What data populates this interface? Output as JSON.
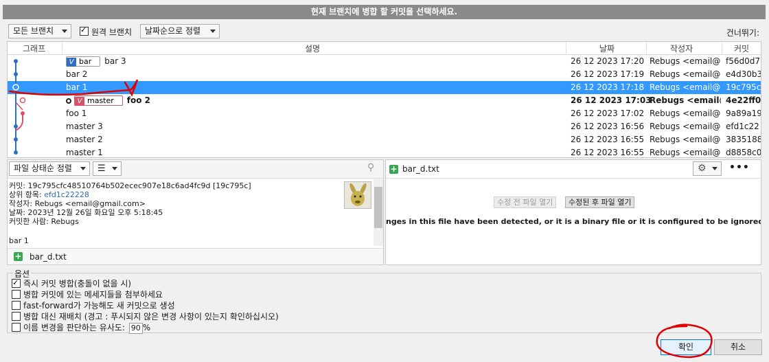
{
  "title": "현재 브랜치에 병합 할 커밋을 선택하세요.",
  "toolbar": {
    "branch_filter": "모든 브랜치",
    "remote_branches_label": "원격 브랜치",
    "remote_branches_checked": true,
    "sort_label": "날짜순으로 정렬",
    "skip_label": "건너뛰기:"
  },
  "columns": {
    "graph": "그래프",
    "description": "설명",
    "date": "날짜",
    "author": "작성자",
    "commit": "커밋"
  },
  "commits": [
    {
      "tag": "bar",
      "desc": "bar 3",
      "date": "26 12 2023 17:20",
      "author": "Rebugs <email@g",
      "commit": "f56d0d7"
    },
    {
      "tag": "",
      "desc": "bar 2",
      "date": "26 12 2023 17:19",
      "author": "Rebugs <email@g",
      "commit": "e4d30b3"
    },
    {
      "tag": "",
      "desc": "bar 1",
      "date": "26 12 2023 17:18",
      "author": "Rebugs <email@g",
      "commit": "19c795c"
    },
    {
      "tag": "master",
      "desc": "foo 2",
      "date": "26 12 2023 17:03",
      "author": "Rebugs <email@",
      "commit": "4e22ff0"
    },
    {
      "tag": "",
      "desc": "foo 1",
      "date": "26 12 2023 17:02",
      "author": "Rebugs <email@g",
      "commit": "9a89a19"
    },
    {
      "tag": "",
      "desc": "master 3",
      "date": "26 12 2023 16:56",
      "author": "Rebugs <email@g",
      "commit": "efd1c22"
    },
    {
      "tag": "",
      "desc": "master 2",
      "date": "26 12 2023 16:55",
      "author": "Rebugs <email@g",
      "commit": "3835188"
    },
    {
      "tag": "",
      "desc": "master 1",
      "date": "26 12 2023 16:55",
      "author": "Rebugs <email@g",
      "commit": "d8858c0"
    }
  ],
  "selected_row": 2,
  "details": {
    "file_sort": "파일 상태순 정렬",
    "view_mode_icon": "list-icon",
    "commit_label": "커밋:",
    "commit_value": "19c795cfc48510764b502ecec907e18c6ad4fc9d [19c795c]",
    "parent_label": "상위 항목:",
    "parent_value": "efd1c22228",
    "author_label": "작성자:",
    "author_value": "Rebugs <email@gmail.com>",
    "date_label": "날짜:",
    "date_value": "2023년 12월 26일 화요일 오후 5:18:45",
    "committer_label": "커밋한 사람:",
    "committer_value": "Rebugs",
    "message": "bar 1",
    "file": "bar_d.txt"
  },
  "diff": {
    "file": "bar_d.txt",
    "open_before": "수정 전 파일 열기",
    "open_after": "수정된 후 파일 열기",
    "message": "nges in this file have been detected, or it is a binary file or it is configured to be ignored by the file p"
  },
  "options": {
    "legend": "옵션",
    "items": [
      {
        "label": "즉시 커밋 병합(충돌이 없을 시)",
        "checked": true
      },
      {
        "label": "병합 커밋에 있는 메세지들을 첨부하세요",
        "checked": false
      },
      {
        "label": "fast-forward가 가능해도 새 커밋으로 생성",
        "checked": false
      },
      {
        "label": "병합 대신 재배치 (경고 : 푸시되지 않은 변경 사항이 있는지 확인하십시오)",
        "checked": false
      },
      {
        "label": "이름 변경을 판단하는 유사도:",
        "checked": false
      }
    ],
    "similarity_value": "90",
    "similarity_unit": "%"
  },
  "buttons": {
    "ok": "확인",
    "cancel": "취소"
  },
  "colors": {
    "selection": "#3399ff",
    "branch_blue": "#2f6fbf",
    "branch_red": "#d9506a",
    "annotation_red": "#e00000"
  }
}
